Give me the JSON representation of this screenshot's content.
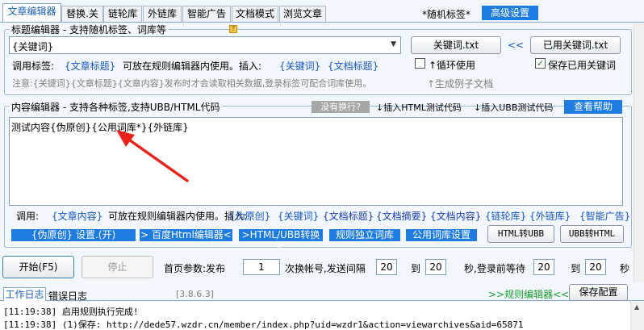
{
  "tabs": [
    "文章编辑器",
    "替换.关",
    "链轮库",
    "外链库",
    "智能广告",
    "文档模式",
    "浏览文章"
  ],
  "header": {
    "random_tag": "*随机标签*",
    "advanced": "高级设置"
  },
  "title_editor": {
    "legend": "标题编辑器 - 支持随机标签、词库等",
    "input_value": "{关键词}",
    "keyword_txt_button": "关键词.txt",
    "arrows": "<<",
    "used_keyword_button": "已用关键词.txt",
    "call_tag_label": "调用标签:",
    "article_title_tag": "{文章标题}",
    "usable_text": "可放在规则编辑器内使用。插入:",
    "insert_keyword": "{关键词}",
    "insert_doc_title": "{文档标题}",
    "loop_use": "↑循环使用",
    "save_used_keyword": "保存已用关键词",
    "notice": "注意:{关键词}{文章标题}{文章内容}发布时才会读取相关数据,登录标签可配合词库使用。",
    "gen_example": "↑生成例子文档"
  },
  "content_editor": {
    "legend": "内容编辑器 - 支持各种标签,支持UBB/HTML代码",
    "no_wrap": "没有换行?",
    "insert_html_test": "↓插入HTML测试代码",
    "insert_ubb_test": "↓插入UBB测试代码",
    "view_help": "查看帮助",
    "content_value": "测试内容{伪原创}{公用词库*}{外链库}",
    "call_label": "调用:",
    "article_content_tag": "{文章内容}",
    "usable_text": "可放在规则编辑器内使用。插入:",
    "insert_tags": [
      "{伪原创}",
      "{关键词}",
      "{文档标题}",
      "{文档摘要}",
      "{文档内容}",
      "{链轮库}",
      "{外链库}",
      "{智能广告}"
    ],
    "pseudo_original_btn": "{伪原创} 设置.(开)",
    "baidu_editor_btn": "> 百度Html编辑器<",
    "html_ubb_btn": ">HTML/UBB转换<",
    "rule_lexicon_btn": "规则独立词库",
    "public_lexicon_btn": "公用词库设置",
    "html_to_ubb": "HTML转UBB",
    "ubb_to_html": "UBB转HTML"
  },
  "controls": {
    "start": "开始(F5)",
    "stop": "停止",
    "params_label": "首页参数:发布",
    "publish_count": "1",
    "switch_text": "次换帐号,发送间隔",
    "interval_from": "20",
    "to1": "到",
    "interval_to": "20",
    "wait_text": "秒,登录前等待",
    "wait_from": "20",
    "to2": "到",
    "wait_to": "20",
    "seconds": "秒"
  },
  "log": {
    "tab_work": "工作日志",
    "tab_error": "错误日志",
    "version": "[3.8.6.3]",
    "rule_editor": ">>规则编辑器<<",
    "save_config": "保存配置",
    "lines": [
      "[11:19:38] 启用规则执行完成!",
      "[11:19:38] (1)保存: http://dede57.wzdr.cn/member/index.php?uid=wzdr1&action=viewarchives&aid=65871"
    ]
  },
  "colors": {
    "accent": "#1e7be0",
    "arrow": "#e8231b",
    "link": "#1856c7"
  }
}
